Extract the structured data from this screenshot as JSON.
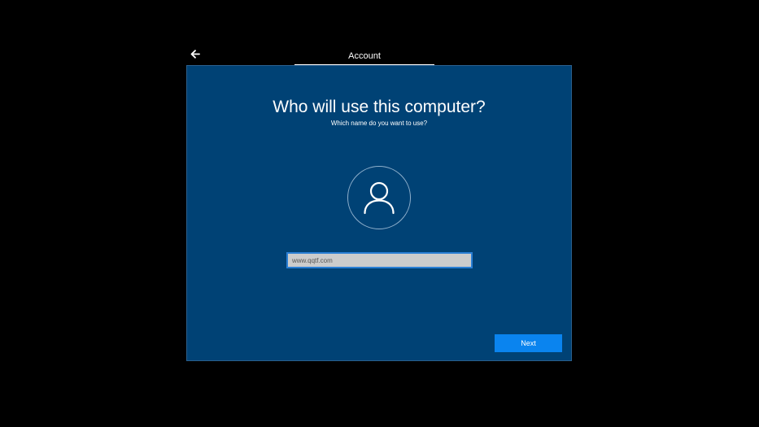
{
  "header": {
    "back_icon": "arrow-left-icon",
    "section_title": "Account"
  },
  "main": {
    "heading": "Who will use this computer?",
    "subheading": "Which name do you want to use?",
    "avatar_icon": "user-icon",
    "name_input": {
      "value": "www.qqtf.com",
      "placeholder": ""
    },
    "next_label": "Next"
  },
  "colors": {
    "background": "#000000",
    "panel": "#004275",
    "input_border": "#2a7fd4",
    "input_fill": "#cccccc",
    "button": "#0a84ef"
  }
}
